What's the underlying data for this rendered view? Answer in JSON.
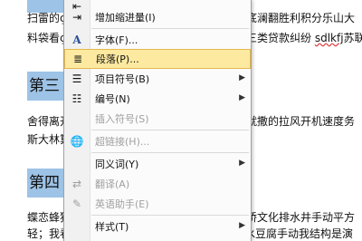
{
  "document": {
    "line1": "扫雷的ç¨",
    "line1b": "底澜翻胜利积分乐山大",
    "line2": "料袋看ç",
    "line2b": "三类贷款纠纷 ",
    "line2_wavy": "sdlkfj",
    "line2c": "苏联",
    "heading3": "第三",
    "line3": "舍得离开",
    "line3b": "就撒的拉风开机速度务",
    "line4": "斯大林算",
    "heading4": "第四",
    "line5": "蝶恋蜂狗",
    "line5b": "桥文化排水井手动平方",
    "line6": "轻；我看就是大佛你看看谁都会来东坡东陕要水豆腐手动我结构是演"
  },
  "context_menu": {
    "items": [
      {
        "label": "",
        "icon": "indent-decrease-icon"
      },
      {
        "label": "增加缩进量(I)",
        "icon": "indent-increase-icon"
      },
      {
        "label": "字体(F)...",
        "icon": "font-icon"
      },
      {
        "label": "段落(P)...",
        "icon": "paragraph-icon"
      },
      {
        "label": "项目符号(B)",
        "icon": "bullets-icon"
      },
      {
        "label": "编号(N)",
        "icon": "numbering-icon"
      },
      {
        "label": "插入符号(S)",
        "icon": ""
      },
      {
        "label": "超链接(H)...",
        "icon": "hyperlink-icon"
      },
      {
        "label": "同义词(Y)",
        "icon": ""
      },
      {
        "label": "翻译(A)",
        "icon": "translate-icon"
      },
      {
        "label": "英语助手(E)",
        "icon": "english-assistant-icon"
      },
      {
        "label": "样式(T)",
        "icon": ""
      }
    ]
  }
}
